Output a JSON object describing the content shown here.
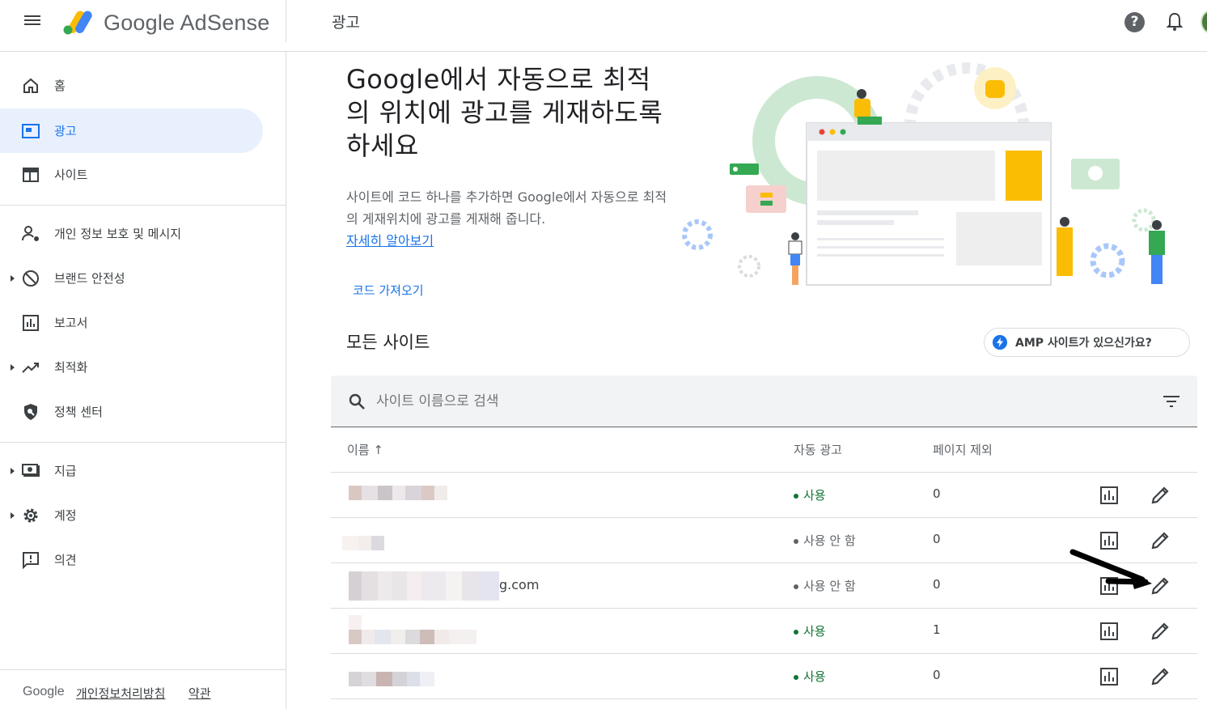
{
  "topbar": {
    "brand": "Google AdSense",
    "page_title": "광고"
  },
  "sidebar": {
    "items": [
      {
        "label": "홈",
        "icon": "home-icon"
      },
      {
        "label": "광고",
        "icon": "ads-icon",
        "active": true
      },
      {
        "label": "사이트",
        "icon": "sites-icon"
      },
      {
        "label": "개인 정보 보호 및 메시지",
        "icon": "privacy-messaging-icon"
      },
      {
        "label": "브랜드 안전성",
        "icon": "block-icon"
      },
      {
        "label": "보고서",
        "icon": "report-icon"
      },
      {
        "label": "최적화",
        "icon": "trending-icon"
      },
      {
        "label": "정책 센터",
        "icon": "policy-shield-icon"
      },
      {
        "label": "지급",
        "icon": "payments-icon"
      },
      {
        "label": "계정",
        "icon": "gear-icon"
      },
      {
        "label": "의견",
        "icon": "feedback-icon"
      }
    ],
    "footer": {
      "google": "Google",
      "privacy": "개인정보처리방침",
      "terms": "약관"
    }
  },
  "hero": {
    "title": "Google에서 자동으로 최적의 위치에 광고를 게재하도록 하세요",
    "description": "사이트에 코드 하나를 추가하면 Google에서 자동으로 최적의 게재위치에 광고를 게재해 줍니다.",
    "learn_more": "자세히 알아보기",
    "get_code": "코드 가져오기"
  },
  "sites": {
    "section_title": "모든 사이트",
    "amp_button": "AMP 사이트가 있으신가요?",
    "search_placeholder": "사이트 이름으로 검색",
    "columns": {
      "name": "이름 ↑",
      "auto_ads": "자동 광고",
      "page_exclusions": "페이지 제외"
    },
    "rows": [
      {
        "name": "",
        "auto_ads": "사용",
        "enabled": true,
        "exclusions": "0"
      },
      {
        "name": "",
        "auto_ads": "사용 안 함",
        "enabled": false,
        "exclusions": "0"
      },
      {
        "name": "g.com",
        "auto_ads": "사용 안 함",
        "enabled": false,
        "exclusions": "0"
      },
      {
        "name": "",
        "auto_ads": "사용",
        "enabled": true,
        "exclusions": "1"
      },
      {
        "name": "",
        "auto_ads": "사용",
        "enabled": true,
        "exclusions": "0"
      }
    ]
  },
  "colors": {
    "accent": "#1a73e8",
    "active_bg": "#e8f0fe",
    "status_on": "#137333",
    "status_off": "#5f6368"
  }
}
